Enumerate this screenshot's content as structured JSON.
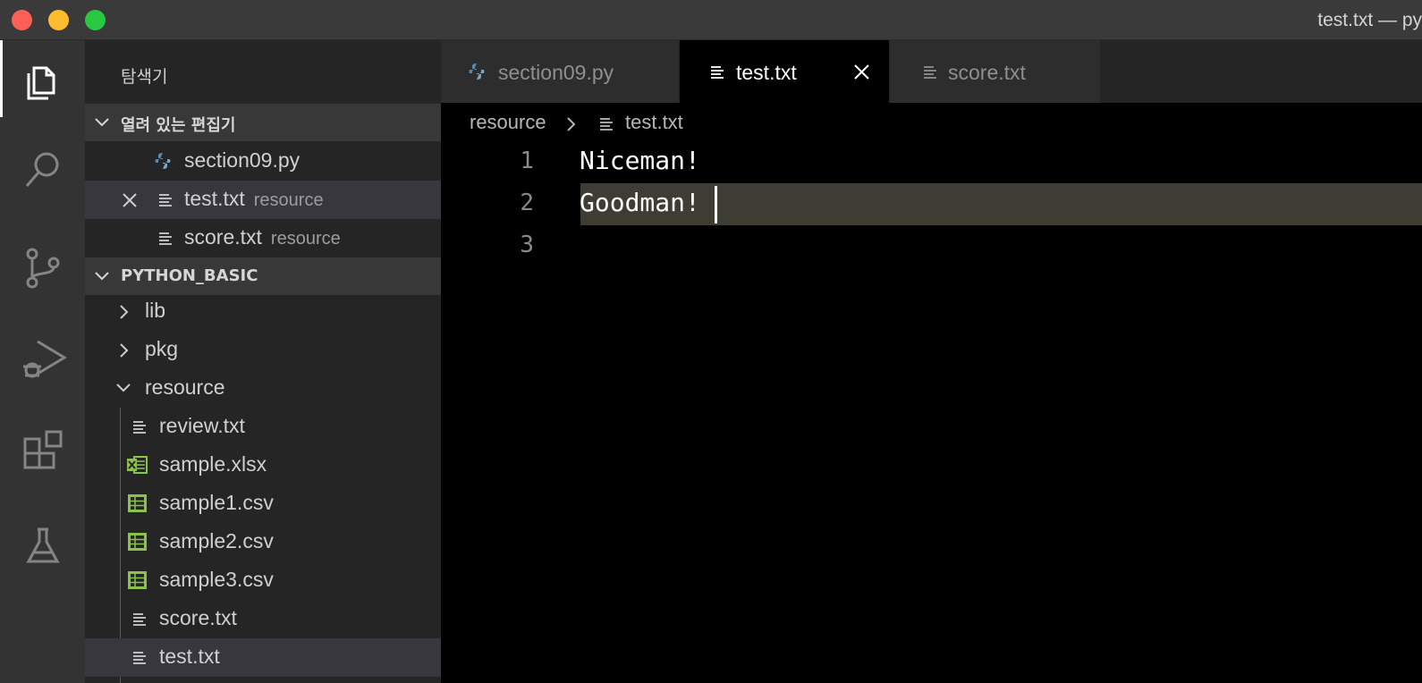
{
  "window": {
    "title": "test.txt — py"
  },
  "activity_bar": {
    "items": [
      "explorer-icon",
      "search-icon",
      "source-control-icon",
      "run-debug-icon",
      "extensions-icon",
      "testing-icon"
    ]
  },
  "sidebar": {
    "title": "탐색기",
    "open_editors": {
      "header": "열려 있는 편집기",
      "items": [
        {
          "name": "section09.py",
          "description": "",
          "icon": "python-icon"
        },
        {
          "name": "test.txt",
          "description": "resource",
          "icon": "text-file-icon"
        },
        {
          "name": "score.txt",
          "description": "resource",
          "icon": "text-file-icon"
        }
      ]
    },
    "workspace": {
      "header": "PYTHON_BASIC",
      "items": [
        {
          "name": "lib",
          "type": "folder",
          "expanded": false
        },
        {
          "name": "pkg",
          "type": "folder",
          "expanded": false
        },
        {
          "name": "resource",
          "type": "folder",
          "expanded": true
        },
        {
          "name": "review.txt",
          "type": "file",
          "icon": "text-file-icon"
        },
        {
          "name": "sample.xlsx",
          "type": "file",
          "icon": "excel-icon"
        },
        {
          "name": "sample1.csv",
          "type": "file",
          "icon": "csv-icon"
        },
        {
          "name": "sample2.csv",
          "type": "file",
          "icon": "csv-icon"
        },
        {
          "name": "sample3.csv",
          "type": "file",
          "icon": "csv-icon"
        },
        {
          "name": "score.txt",
          "type": "file",
          "icon": "text-file-icon"
        },
        {
          "name": "test.txt",
          "type": "file",
          "icon": "text-file-icon"
        }
      ]
    }
  },
  "tabs": [
    {
      "label": "section09.py",
      "icon": "python-icon",
      "active": false
    },
    {
      "label": "test.txt",
      "icon": "text-file-icon",
      "active": true
    },
    {
      "label": "score.txt",
      "icon": "text-file-icon",
      "active": false
    }
  ],
  "breadcrumb": {
    "folder": "resource",
    "file": "test.txt"
  },
  "editor": {
    "lines": [
      {
        "number": "1",
        "text": "Niceman!"
      },
      {
        "number": "2",
        "text": "Goodman!"
      },
      {
        "number": "3",
        "text": ""
      }
    ]
  },
  "colors": {
    "activity_bar": "#333333",
    "sidebar": "#252526",
    "editor_bg": "#000000",
    "current_line": "#3d3d33",
    "python_blue": "#4f8ab8",
    "csv_green": "#8bc34a"
  }
}
